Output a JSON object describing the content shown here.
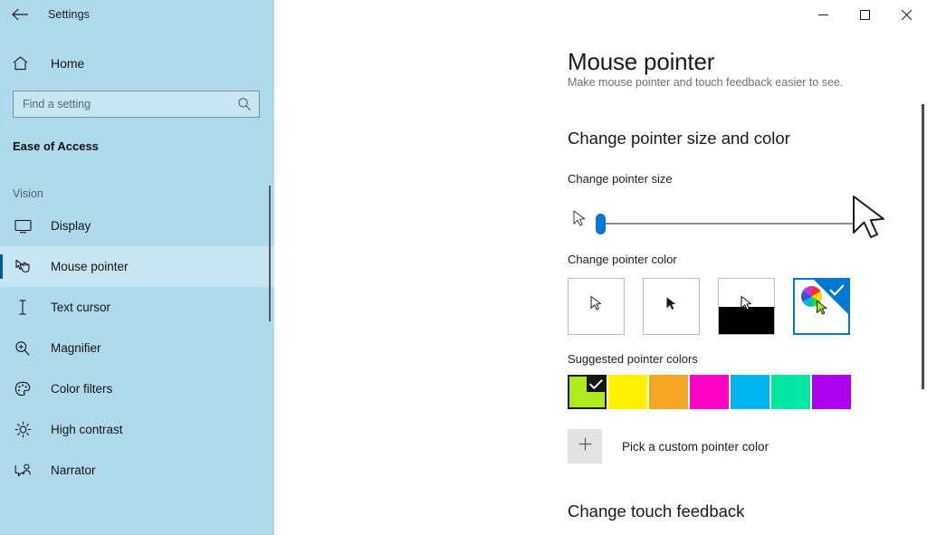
{
  "titlebar": {
    "back_icon": "arrow-left-icon",
    "title": "Settings",
    "minimize_icon": "minimize-icon",
    "maximize_icon": "maximize-icon",
    "close_icon": "close-icon"
  },
  "sidebar": {
    "background_color": "#AFDAEC",
    "accent_color": "#005A9E",
    "home": {
      "icon": "home-icon",
      "label": "Home"
    },
    "search": {
      "icon": "search-icon",
      "placeholder": "Find a setting",
      "value": ""
    },
    "category": "Ease of Access",
    "group_title": "Vision",
    "items": [
      {
        "icon": "monitor-icon",
        "label": "Display",
        "selected": false
      },
      {
        "icon": "mouse-pointer-icon",
        "label": "Mouse pointer",
        "selected": true
      },
      {
        "icon": "text-cursor-icon",
        "label": "Text cursor",
        "selected": false
      },
      {
        "icon": "magnifier-icon",
        "label": "Magnifier",
        "selected": false
      },
      {
        "icon": "palette-icon",
        "label": "Color filters",
        "selected": false
      },
      {
        "icon": "brightness-icon",
        "label": "High contrast",
        "selected": false
      },
      {
        "icon": "narrator-icon",
        "label": "Narrator",
        "selected": false
      }
    ]
  },
  "main": {
    "page_title": "Mouse pointer",
    "page_subtitle": "Make mouse pointer and touch feedback easier to see.",
    "section_title": "Change pointer size and color",
    "pointer_size": {
      "label": "Change pointer size",
      "value": 1,
      "min": 1,
      "max": 15,
      "thumb_color": "#0078D4"
    },
    "pointer_color": {
      "label": "Change pointer color",
      "options": [
        {
          "name": "white-pointer-option",
          "selected": false
        },
        {
          "name": "black-pointer-option",
          "selected": false
        },
        {
          "name": "inverted-pointer-option",
          "selected": false
        },
        {
          "name": "custom-pointer-option",
          "selected": true
        }
      ]
    },
    "suggested_colors": {
      "label": "Suggested pointer colors",
      "swatches": [
        {
          "name": "lime-green",
          "color": "#AEEA1E",
          "selected": true
        },
        {
          "name": "yellow",
          "color": "#FFF100",
          "selected": false
        },
        {
          "name": "orange",
          "color": "#F5A623",
          "selected": false
        },
        {
          "name": "magenta",
          "color": "#FF00C4",
          "selected": false
        },
        {
          "name": "cyan",
          "color": "#00B5EF",
          "selected": false
        },
        {
          "name": "spring-green",
          "color": "#00E8A4",
          "selected": false
        },
        {
          "name": "purple",
          "color": "#AE00F0",
          "selected": false
        }
      ]
    },
    "custom_color": {
      "icon": "plus-icon",
      "label": "Pick a custom pointer color"
    },
    "touch_section_title": "Change touch feedback"
  }
}
